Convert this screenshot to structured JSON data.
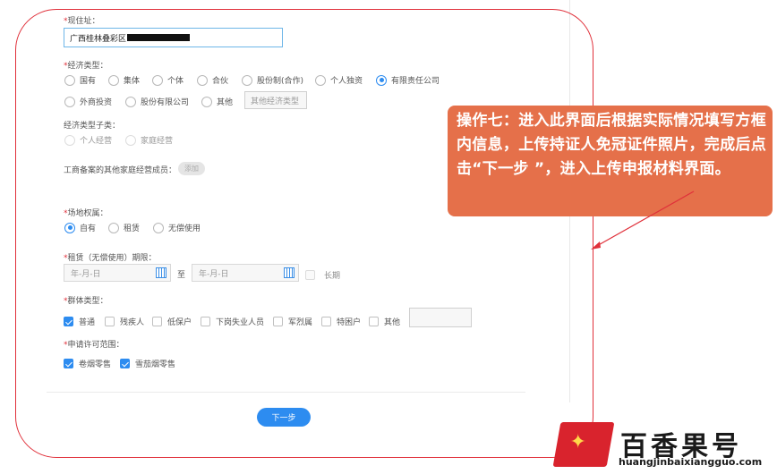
{
  "address": {
    "label": "现住址：",
    "value": "广西桂林叠彩区"
  },
  "econ_type": {
    "label": "经济类型：",
    "options": [
      "国有",
      "集体",
      "个体",
      "合伙",
      "股份制(合作)",
      "个人独资",
      "有限责任公司",
      "外商投资",
      "股份有限公司",
      "其他"
    ],
    "selected": "有限责任公司",
    "other_placeholder": "其他经济类型"
  },
  "econ_subtype": {
    "label": "经济类型子类：",
    "options": [
      "个人经营",
      "家庭经营"
    ]
  },
  "family_members": {
    "label": "工商备案的其他家庭经营成员：",
    "add_label": "添加"
  },
  "site_ownership": {
    "label": "场地权属：",
    "options": [
      "自有",
      "租赁",
      "无偿使用"
    ],
    "selected": "自有"
  },
  "lease_period": {
    "label": "租赁（无偿使用）期限：",
    "start_placeholder": "年-月-日",
    "to_label": "至",
    "end_placeholder": "年-月-日",
    "long_term_label": "长期"
  },
  "group_type": {
    "label": "群体类型：",
    "options": [
      "普通",
      "残疾人",
      "低保户",
      "下岗失业人员",
      "军烈属",
      "特困户",
      "其他"
    ],
    "checked": [
      "普通"
    ]
  },
  "license_scope": {
    "label": "申请许可范围：",
    "options": [
      "卷烟零售",
      "雪茄烟零售"
    ],
    "checked": [
      "卷烟零售",
      "雪茄烟零售"
    ]
  },
  "next_label": "下一步",
  "callout": "操作七：进入此界面后根据实际情况填写方框内信息，上传持证人免冠证件照片，完成后点击“下一步 ”，进入上传申报材料界面。",
  "watermark": {
    "brand": "百香果号",
    "site": "huangjinbaixiangguo.com"
  },
  "colors": {
    "accent": "#2d8cf0",
    "annotation": "#e0303a",
    "callout_bg": "#e5704a"
  }
}
